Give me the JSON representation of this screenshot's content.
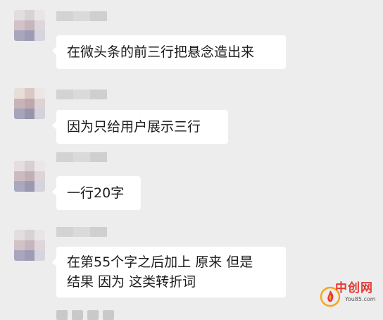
{
  "chat": {
    "messages": [
      {
        "text": "在微头条的前三行把悬念造出来"
      },
      {
        "text": "因为只给用户展示三行"
      },
      {
        "text": "一行20字"
      },
      {
        "line1": "在第55个字之后加上 原来 但是",
        "line2": "结果 因为 这类转折词"
      }
    ]
  },
  "watermark": {
    "brand": "中创网",
    "url": "You85.com",
    "logo_icon": "flame-logo-icon"
  },
  "colors": {
    "background": "#ededed",
    "bubble": "#ffffff",
    "text": "#1b1b1b",
    "brand_red": "#e53935"
  }
}
